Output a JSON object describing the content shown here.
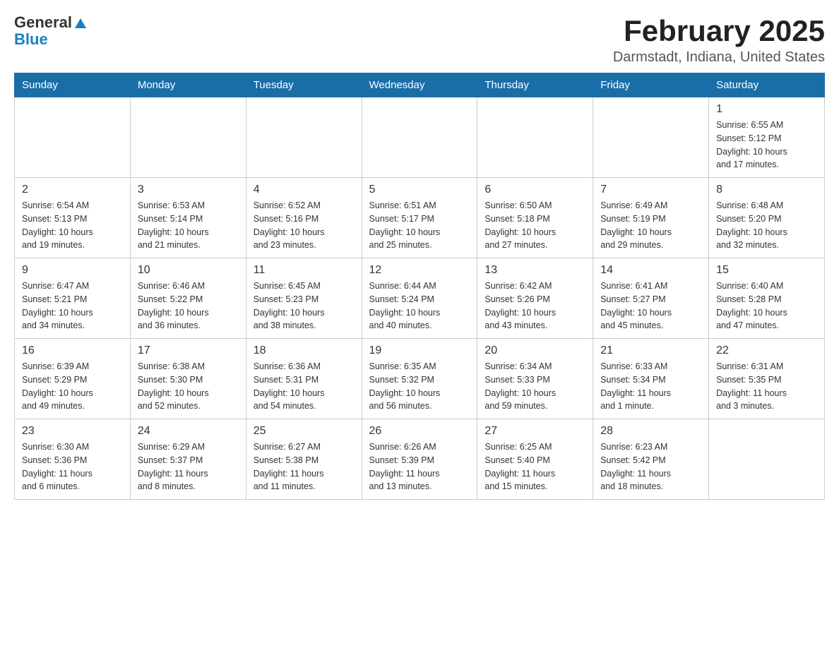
{
  "header": {
    "logo_general": "General",
    "logo_blue": "Blue",
    "month_title": "February 2025",
    "location": "Darmstadt, Indiana, United States"
  },
  "days_of_week": [
    "Sunday",
    "Monday",
    "Tuesday",
    "Wednesday",
    "Thursday",
    "Friday",
    "Saturday"
  ],
  "weeks": [
    [
      {
        "day": "",
        "info": ""
      },
      {
        "day": "",
        "info": ""
      },
      {
        "day": "",
        "info": ""
      },
      {
        "day": "",
        "info": ""
      },
      {
        "day": "",
        "info": ""
      },
      {
        "day": "",
        "info": ""
      },
      {
        "day": "1",
        "info": "Sunrise: 6:55 AM\nSunset: 5:12 PM\nDaylight: 10 hours\nand 17 minutes."
      }
    ],
    [
      {
        "day": "2",
        "info": "Sunrise: 6:54 AM\nSunset: 5:13 PM\nDaylight: 10 hours\nand 19 minutes."
      },
      {
        "day": "3",
        "info": "Sunrise: 6:53 AM\nSunset: 5:14 PM\nDaylight: 10 hours\nand 21 minutes."
      },
      {
        "day": "4",
        "info": "Sunrise: 6:52 AM\nSunset: 5:16 PM\nDaylight: 10 hours\nand 23 minutes."
      },
      {
        "day": "5",
        "info": "Sunrise: 6:51 AM\nSunset: 5:17 PM\nDaylight: 10 hours\nand 25 minutes."
      },
      {
        "day": "6",
        "info": "Sunrise: 6:50 AM\nSunset: 5:18 PM\nDaylight: 10 hours\nand 27 minutes."
      },
      {
        "day": "7",
        "info": "Sunrise: 6:49 AM\nSunset: 5:19 PM\nDaylight: 10 hours\nand 29 minutes."
      },
      {
        "day": "8",
        "info": "Sunrise: 6:48 AM\nSunset: 5:20 PM\nDaylight: 10 hours\nand 32 minutes."
      }
    ],
    [
      {
        "day": "9",
        "info": "Sunrise: 6:47 AM\nSunset: 5:21 PM\nDaylight: 10 hours\nand 34 minutes."
      },
      {
        "day": "10",
        "info": "Sunrise: 6:46 AM\nSunset: 5:22 PM\nDaylight: 10 hours\nand 36 minutes."
      },
      {
        "day": "11",
        "info": "Sunrise: 6:45 AM\nSunset: 5:23 PM\nDaylight: 10 hours\nand 38 minutes."
      },
      {
        "day": "12",
        "info": "Sunrise: 6:44 AM\nSunset: 5:24 PM\nDaylight: 10 hours\nand 40 minutes."
      },
      {
        "day": "13",
        "info": "Sunrise: 6:42 AM\nSunset: 5:26 PM\nDaylight: 10 hours\nand 43 minutes."
      },
      {
        "day": "14",
        "info": "Sunrise: 6:41 AM\nSunset: 5:27 PM\nDaylight: 10 hours\nand 45 minutes."
      },
      {
        "day": "15",
        "info": "Sunrise: 6:40 AM\nSunset: 5:28 PM\nDaylight: 10 hours\nand 47 minutes."
      }
    ],
    [
      {
        "day": "16",
        "info": "Sunrise: 6:39 AM\nSunset: 5:29 PM\nDaylight: 10 hours\nand 49 minutes."
      },
      {
        "day": "17",
        "info": "Sunrise: 6:38 AM\nSunset: 5:30 PM\nDaylight: 10 hours\nand 52 minutes."
      },
      {
        "day": "18",
        "info": "Sunrise: 6:36 AM\nSunset: 5:31 PM\nDaylight: 10 hours\nand 54 minutes."
      },
      {
        "day": "19",
        "info": "Sunrise: 6:35 AM\nSunset: 5:32 PM\nDaylight: 10 hours\nand 56 minutes."
      },
      {
        "day": "20",
        "info": "Sunrise: 6:34 AM\nSunset: 5:33 PM\nDaylight: 10 hours\nand 59 minutes."
      },
      {
        "day": "21",
        "info": "Sunrise: 6:33 AM\nSunset: 5:34 PM\nDaylight: 11 hours\nand 1 minute."
      },
      {
        "day": "22",
        "info": "Sunrise: 6:31 AM\nSunset: 5:35 PM\nDaylight: 11 hours\nand 3 minutes."
      }
    ],
    [
      {
        "day": "23",
        "info": "Sunrise: 6:30 AM\nSunset: 5:36 PM\nDaylight: 11 hours\nand 6 minutes."
      },
      {
        "day": "24",
        "info": "Sunrise: 6:29 AM\nSunset: 5:37 PM\nDaylight: 11 hours\nand 8 minutes."
      },
      {
        "day": "25",
        "info": "Sunrise: 6:27 AM\nSunset: 5:38 PM\nDaylight: 11 hours\nand 11 minutes."
      },
      {
        "day": "26",
        "info": "Sunrise: 6:26 AM\nSunset: 5:39 PM\nDaylight: 11 hours\nand 13 minutes."
      },
      {
        "day": "27",
        "info": "Sunrise: 6:25 AM\nSunset: 5:40 PM\nDaylight: 11 hours\nand 15 minutes."
      },
      {
        "day": "28",
        "info": "Sunrise: 6:23 AM\nSunset: 5:42 PM\nDaylight: 11 hours\nand 18 minutes."
      },
      {
        "day": "",
        "info": ""
      }
    ]
  ]
}
